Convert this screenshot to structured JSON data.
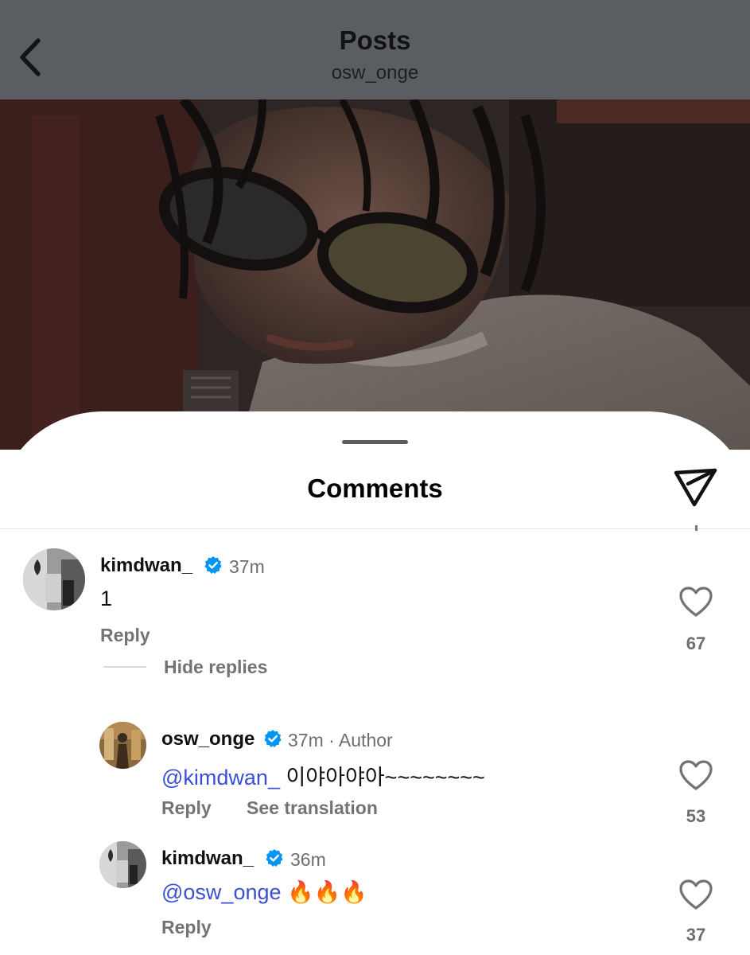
{
  "header": {
    "title": "Posts",
    "subtitle": "osw_onge"
  },
  "sheet": {
    "title": "Comments"
  },
  "comments": [
    {
      "username": "kimdwan_",
      "verified": true,
      "time": "37m",
      "text": "1",
      "reply_label": "Reply",
      "likes": "67",
      "hide_replies_label": "Hide replies",
      "replies": [
        {
          "username": "osw_onge",
          "verified": true,
          "time": "37m",
          "author_tag": "· Author",
          "mention": "@kimdwan_",
          "text": " 이야아야아~~~~~~~~",
          "reply_label": "Reply",
          "translate_label": "See translation",
          "likes": "53"
        },
        {
          "username": "kimdwan_",
          "verified": true,
          "time": "36m",
          "mention": "@osw_onge",
          "text": " 🔥🔥🔥",
          "reply_label": "Reply",
          "likes": "37"
        }
      ]
    }
  ],
  "icons": {
    "back": "chevron-left-icon",
    "share": "paper-plane-icon",
    "verified": "verified-badge-icon",
    "like": "heart-outline-icon"
  },
  "colors": {
    "verified_blue": "#0095f6",
    "mention_blue": "#3a4fd1",
    "secondary_text": "#737373"
  }
}
